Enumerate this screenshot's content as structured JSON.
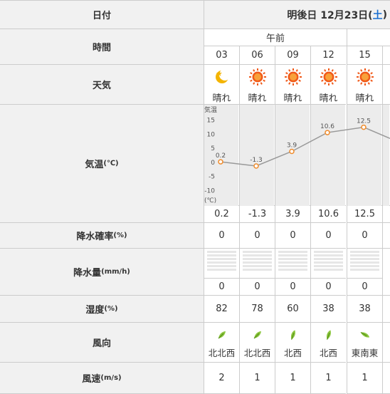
{
  "header": {
    "date_label": "日付",
    "date_prefix": "明後日 12月23日(",
    "day": "土",
    "date_suffix": ")"
  },
  "rows": {
    "time": "時間",
    "weather": "天気",
    "temp": "気温",
    "temp_unit": "(℃)",
    "precip_prob": "降水確率",
    "precip_prob_unit": "(%)",
    "precip": "降水量",
    "precip_unit": "(mm/h)",
    "humidity": "湿度",
    "humidity_unit": "(%)",
    "wind_dir": "風向",
    "wind_speed": "風速",
    "wind_speed_unit": "(m/s)"
  },
  "period_label": "午前",
  "columns": [
    {
      "hour": "03",
      "icon": "moon-icon",
      "weather": "晴れ",
      "temp": "0.2",
      "pop": "0",
      "precip": "0",
      "humidity": "82",
      "wind_dir": "北北西",
      "wind_speed": "2"
    },
    {
      "hour": "06",
      "icon": "sun-icon",
      "weather": "晴れ",
      "temp": "-1.3",
      "pop": "0",
      "precip": "0",
      "humidity": "78",
      "wind_dir": "北北西",
      "wind_speed": "1"
    },
    {
      "hour": "09",
      "icon": "sun-icon",
      "weather": "晴れ",
      "temp": "3.9",
      "pop": "0",
      "precip": "0",
      "humidity": "60",
      "wind_dir": "北西",
      "wind_speed": "1"
    },
    {
      "hour": "12",
      "icon": "sun-icon",
      "weather": "晴れ",
      "temp": "10.6",
      "pop": "0",
      "precip": "0",
      "humidity": "38",
      "wind_dir": "北西",
      "wind_speed": "1"
    },
    {
      "hour": "15",
      "icon": "sun-icon",
      "weather": "晴れ",
      "temp": "12.5",
      "pop": "0",
      "precip": "0",
      "humidity": "38",
      "wind_dir": "東南東",
      "wind_speed": "1"
    }
  ],
  "chart_data": {
    "type": "line",
    "x": [
      "03",
      "06",
      "09",
      "12",
      "15"
    ],
    "series": [
      {
        "values": [
          0.2,
          -1.3,
          3.9,
          10.6,
          12.5
        ]
      }
    ],
    "ylabel_top": "気温",
    "ylabel_bottom": "(℃)",
    "yticks": [
      "15",
      "10",
      "5",
      "0",
      "-5",
      "-10"
    ],
    "ylim": [
      -15,
      20
    ],
    "line_color": "#999999",
    "point_color": "#f08c2c"
  }
}
